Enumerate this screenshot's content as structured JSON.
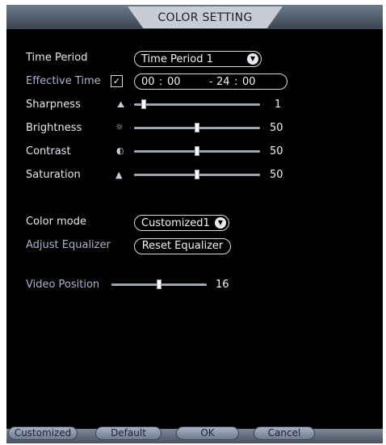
{
  "title": "COLOR SETTING",
  "time_period": {
    "label": "Time Period",
    "value": "Time Period 1"
  },
  "effective_time": {
    "label": "Effective Time",
    "checked": true,
    "start_h": "00",
    "start_m": "00",
    "end_h": "24",
    "end_m": "00",
    "sep": ":",
    "dash": "-"
  },
  "sliders": [
    {
      "label": "Sharpness",
      "value": "1",
      "level": 0.08,
      "icon": "sharpness-icon"
    },
    {
      "label": "Brightness",
      "value": "50",
      "level": 0.5,
      "icon": "brightness-icon"
    },
    {
      "label": "Contrast",
      "value": "50",
      "level": 0.5,
      "icon": "contrast-icon"
    },
    {
      "label": "Saturation",
      "value": "50",
      "level": 0.5,
      "icon": "saturation-icon"
    }
  ],
  "color_mode": {
    "label": "Color mode",
    "value": "Customized1"
  },
  "adjust_equalizer": {
    "label": "Adjust Equalizer",
    "button": "Reset Equalizer"
  },
  "video_position": {
    "label": "Video Position",
    "value": "16",
    "level": 0.5
  },
  "buttons": {
    "customized": "Customized",
    "default": "Default",
    "ok": "OK",
    "cancel": "Cancel"
  },
  "colors": {
    "background": "#000000",
    "title_tab": "#c7ccd6",
    "text": "#e6e6ef"
  }
}
